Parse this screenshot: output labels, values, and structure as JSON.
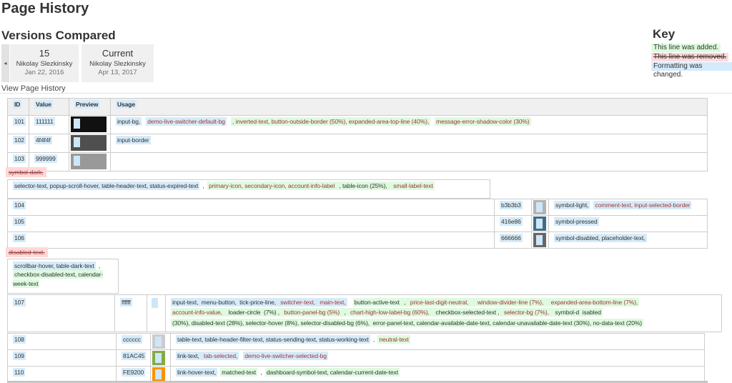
{
  "page_title": "Page History",
  "versions": {
    "heading": "Versions Compared",
    "back_arrow": "◂",
    "old": {
      "label": "15",
      "author": "Nikolay Slezkinsky",
      "date": "Jan 22, 2016"
    },
    "new": {
      "label": "Current",
      "author": "Nikolay Slezkinsky",
      "date": "Apr 13, 2017"
    },
    "view_link": "View Page History"
  },
  "key": {
    "heading": "Key",
    "added": "This line was added.",
    "removed": "This line was removed.",
    "changed": "Formatting was changed."
  },
  "palette": {
    "highlight_changed_blue": "#d6ebf9",
    "highlight_added_green": "#defadf",
    "highlight_removed_pink": "#ffd8d8",
    "text_dark": "#333333",
    "text_red": "#9e3636",
    "swatch_highlight": "#cde7f8",
    "border": "#cccccc"
  },
  "diff": {
    "fragments": [
      {
        "id": "main",
        "kind": "table",
        "header": [
          "ID",
          "Value",
          "Preview",
          "Usage"
        ],
        "rows": [
          {
            "id": "101",
            "value": "111111",
            "swatch": {
              "color": "#111111",
              "wide": true
            },
            "usage": [
              {
                "t": "input-bg,",
                "bg": "blue",
                "c": "dark"
              },
              {
                "gap": 6
              },
              {
                "t": "demo-live-switcher-default-bg",
                "bg": "blue",
                "c": "red"
              },
              {
                "t": " ",
                "bg": "none",
                "c": "dark"
              },
              {
                "t": ", inverted-text, button-outside-border (50%), expanded-area-top-line (40%),",
                "bg": "green",
                "c": "red"
              },
              {
                "gap": 6
              },
              {
                "t": "message-error-shadow-color (30%)",
                "bg": "green",
                "c": "red"
              }
            ]
          },
          {
            "id": "102",
            "value": "4f4f4f",
            "swatch": {
              "color": "#4f4f4f",
              "wide": true
            },
            "usage": [
              {
                "t": "input-border",
                "bg": "blue",
                "c": "dark"
              }
            ]
          },
          {
            "id": "103",
            "value": "999999",
            "swatch": {
              "color": "#999999",
              "wide": true
            },
            "usage": []
          }
        ]
      },
      {
        "id": "removed-1",
        "kind": "removed",
        "text": "symbol-dark,"
      },
      {
        "id": "selector",
        "kind": "table",
        "single": true,
        "rows": [
          {
            "usage": [
              {
                "t": "selector-text, popup-scroll-hover, table-header-text, status-expired-text",
                "bg": "blue",
                "c": "dark"
              },
              {
                "t": " , ",
                "bg": "none",
                "c": "dark"
              },
              {
                "t": "primary-icon, secondary-icon, account-info-label",
                "bg": "green",
                "c": "red"
              },
              {
                "t": " , table-icon (25%),  ",
                "bg": "green",
                "c": "dark"
              },
              {
                "t": "small-label-text",
                "bg": "green",
                "c": "red"
              }
            ]
          }
        ]
      },
      {
        "id": "mid",
        "kind": "table",
        "rows": [
          {
            "id": "104",
            "value": "b3b3b3",
            "swatch": {
              "color": "#b3b3b3"
            },
            "usage": [
              {
                "t": "symbol-light,",
                "bg": "blue",
                "c": "dark"
              },
              {
                "gap": 5
              },
              {
                "t": "comment-text, input-selected-border",
                "bg": "blue",
                "c": "red"
              }
            ]
          },
          {
            "id": "105",
            "value": "416e86",
            "swatch": {
              "color": "#416e86"
            },
            "usage": [
              {
                "t": "symbol-pressed",
                "bg": "blue",
                "c": "dark"
              }
            ]
          },
          {
            "id": "106",
            "value": "666666",
            "swatch": {
              "color": "#666666"
            },
            "usage": [
              {
                "t": "symbol-disabled, placeholder-text,",
                "bg": "blue",
                "c": "dark"
              }
            ]
          }
        ]
      },
      {
        "id": "removed-2",
        "kind": "removed",
        "text": "disabled-text."
      },
      {
        "id": "narrow",
        "kind": "table",
        "single": true,
        "rows": [
          {
            "usage": [
              {
                "t": "scrollbar-hover, table-dark-text",
                "bg": "blue",
                "c": "dark"
              },
              {
                "t": " , ",
                "bg": "none",
                "c": "dark"
              },
              {
                "t": "checkbox-disabled-text, calendar-week-text",
                "bg": "green",
                "c": "dark"
              }
            ]
          }
        ]
      },
      {
        "id": "row107",
        "kind": "table",
        "rows": [
          {
            "id": "107",
            "value": "ffffff",
            "swatch": {
              "color": "#ffffff"
            },
            "usage": [
              {
                "t": "input-text,  menu-button,  tick-price-line,",
                "bg": "blue",
                "c": "dark"
              },
              {
                "t": " switcher-text,",
                "bg": "blue",
                "c": "red"
              },
              {
                "t": " main-text,",
                "bg": "blue",
                "c": "red"
              },
              {
                "gap": 8
              },
              {
                "t": "button-active-text",
                "bg": "green",
                "c": "dark"
              },
              {
                "t": " , ",
                "bg": "green",
                "c": "dark"
              },
              {
                "t": "price-last-digit-neutral,",
                "bg": "green",
                "c": "red"
              },
              {
                "t": "  ",
                "bg": "green",
                "c": "dark"
              },
              {
                "t": "window-divider-line (7%),",
                "bg": "green",
                "c": "red"
              },
              {
                "t": " ",
                "bg": "green",
                "c": "dark"
              },
              {
                "t": "expanded-area-bottom-line (7%),",
                "bg": "green",
                "c": "red"
              },
              {
                "br": true
              },
              {
                "t": "account-info-value,",
                "bg": "green",
                "c": "red"
              },
              {
                "t": "  loader-circle  (7%) , ",
                "bg": "green",
                "c": "dark"
              },
              {
                "t": "button-panel-bg (5%)",
                "bg": "green",
                "c": "red"
              },
              {
                "t": " , ",
                "bg": "green",
                "c": "dark"
              },
              {
                "t": "chart-high-low-label-bg (60%),",
                "bg": "green",
                "c": "red"
              },
              {
                "t": "  checkbox-selected-text , ",
                "bg": "green",
                "c": "dark"
              },
              {
                "t": "selector-bg (7%),",
                "bg": "green",
                "c": "red"
              },
              {
                "t": "  symbol-d  isabled",
                "bg": "green",
                "c": "dark"
              },
              {
                "br": true
              },
              {
                "t": "(30%), disabled-text (28%), selector-hover (8%), selector-disabled-bg (6%),  error-panel-text, calendar-available-date-text, calendar-unavailable-date-text (30%), no-data-text (20%)",
                "bg": "green",
                "c": "dark"
              }
            ]
          }
        ]
      },
      {
        "id": "bottom",
        "kind": "table",
        "rows": [
          {
            "id": "108",
            "value": "cccccc",
            "swatch": {
              "color": "#cccccc"
            },
            "usage": [
              {
                "t": "table-text, table-header-filter-text, status-sending-text, status-working-text",
                "bg": "blue",
                "c": "dark"
              },
              {
                "t": " , ",
                "bg": "none",
                "c": "dark"
              },
              {
                "t": "neutral-text",
                "bg": "green",
                "c": "red"
              }
            ]
          },
          {
            "id": "109",
            "value": "81AC45",
            "swatch": {
              "color": "#81AC45"
            },
            "usage": [
              {
                "t": "link-text,",
                "bg": "blue",
                "c": "dark"
              },
              {
                "t": " tab-selected,",
                "bg": "blue",
                "c": "red"
              },
              {
                "gap": 6
              },
              {
                "t": "demo-live-switcher-selected-bg",
                "bg": "blue",
                "c": "red"
              }
            ]
          },
          {
            "id": "110",
            "value": "FE9200",
            "swatch": {
              "color": "#FE9200"
            },
            "usage": [
              {
                "t": "link-hover-text,",
                "bg": "blue",
                "c": "dark"
              },
              {
                "gap": 4
              },
              {
                "t": "matched-text",
                "bg": "green",
                "c": "dark"
              },
              {
                "t": " , ",
                "bg": "none",
                "c": "dark"
              },
              {
                "t": "dashboard-symbol-text, calendar-current-date-text",
                "bg": "green",
                "c": "dark"
              }
            ]
          }
        ]
      },
      {
        "id": "nextbar",
        "kind": "bar"
      }
    ]
  }
}
